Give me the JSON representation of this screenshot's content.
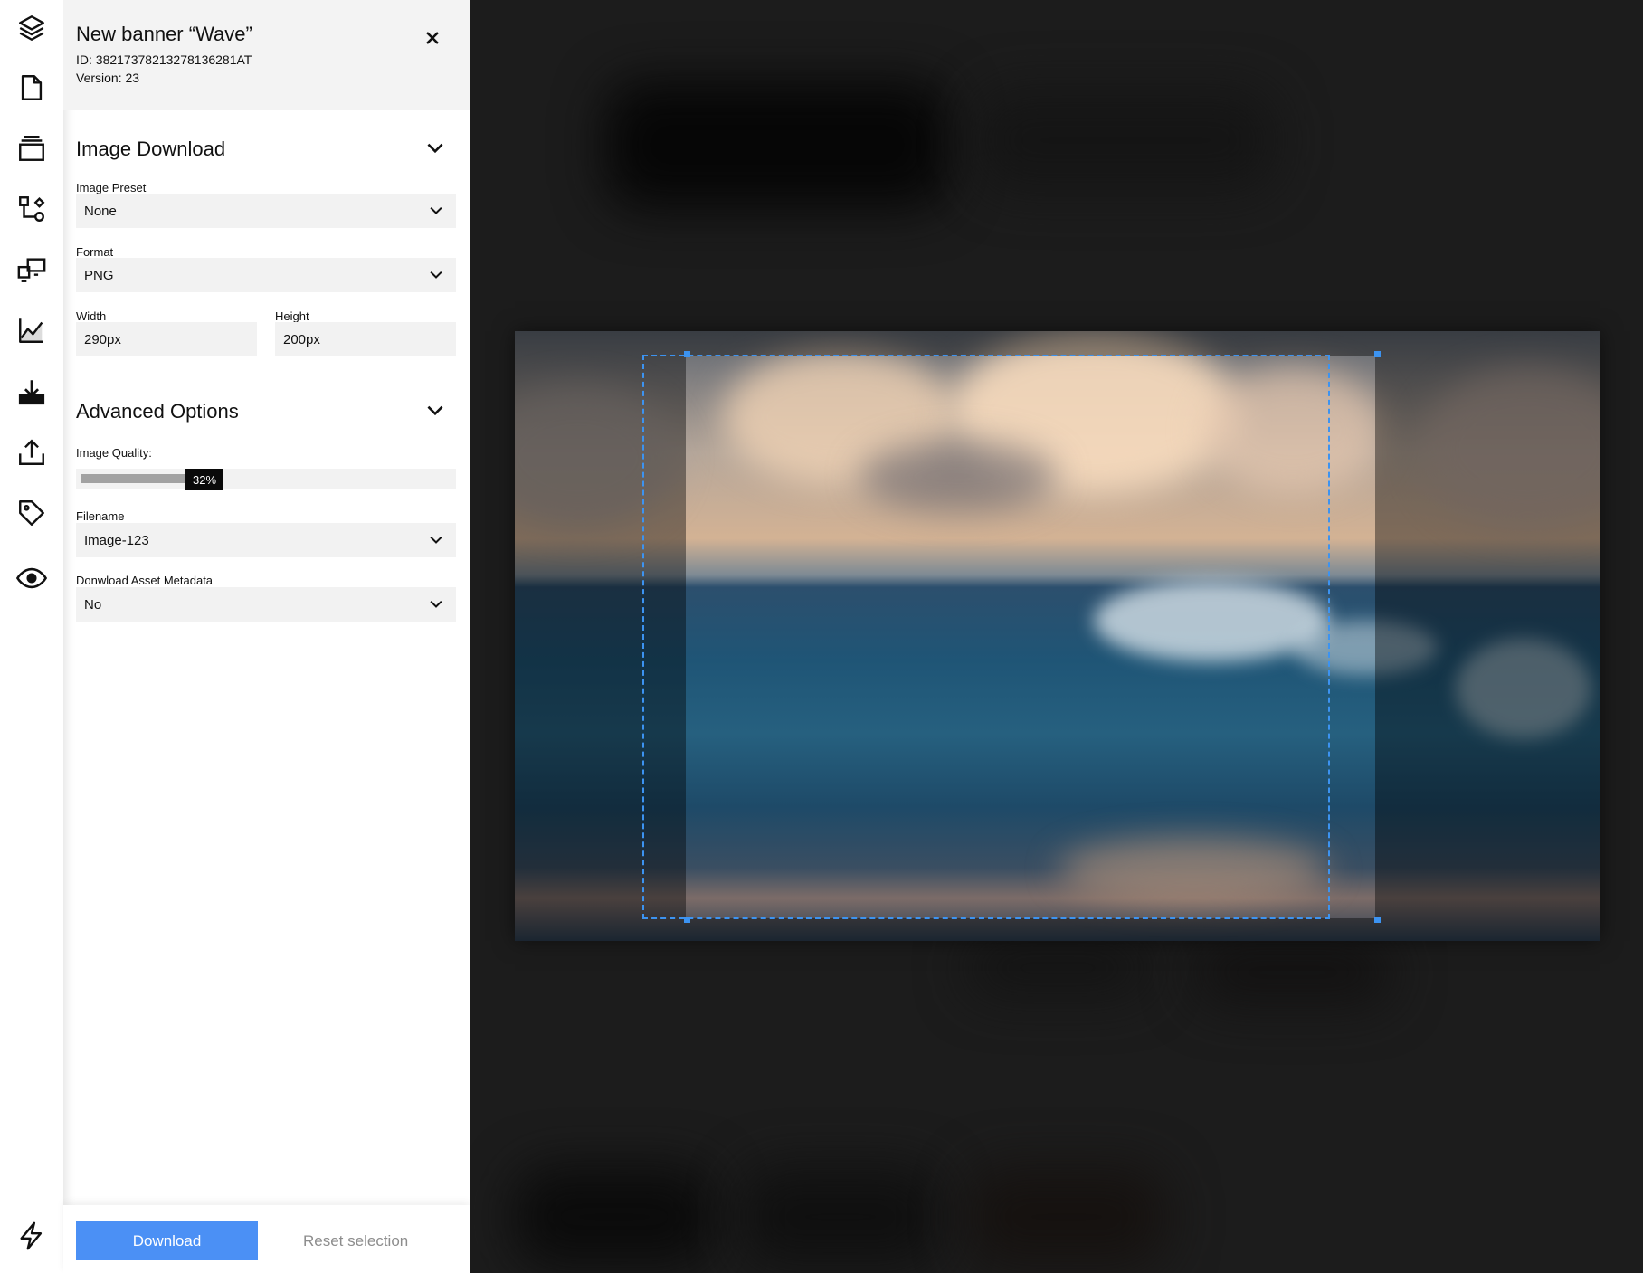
{
  "rail": {
    "icons": [
      "layers-icon",
      "document-icon",
      "stack-icon",
      "workflow-icon",
      "devices-icon",
      "analytics-icon",
      "download-icon",
      "upload-icon",
      "tag-icon",
      "eye-icon",
      "bolt-icon"
    ]
  },
  "panel": {
    "title": "New banner “Wave”",
    "id_line": "ID: 38217378213278136281AT",
    "version_line": "Version: 23"
  },
  "image_download": {
    "heading": "Image Download",
    "preset_label": "Image Preset",
    "preset_value": "None",
    "format_label": "Format",
    "format_value": "PNG",
    "width_label": "Width",
    "width_value": "290px",
    "height_label": "Height",
    "height_value": "200px"
  },
  "advanced": {
    "heading": "Advanced Options",
    "quality_label": "Image Quality:",
    "quality_value": 0.32,
    "quality_text": "32%",
    "filename_label": "Filename",
    "filename_value": "Image-123",
    "metadata_label": "Donwload Asset Metadata",
    "metadata_value": "No"
  },
  "footer": {
    "download_label": "Download",
    "reset_label": "Reset selection"
  },
  "colors": {
    "accent": "#4b90f5",
    "crop_border": "#3c93f1",
    "canvas_bg": "#1c1c1c"
  }
}
